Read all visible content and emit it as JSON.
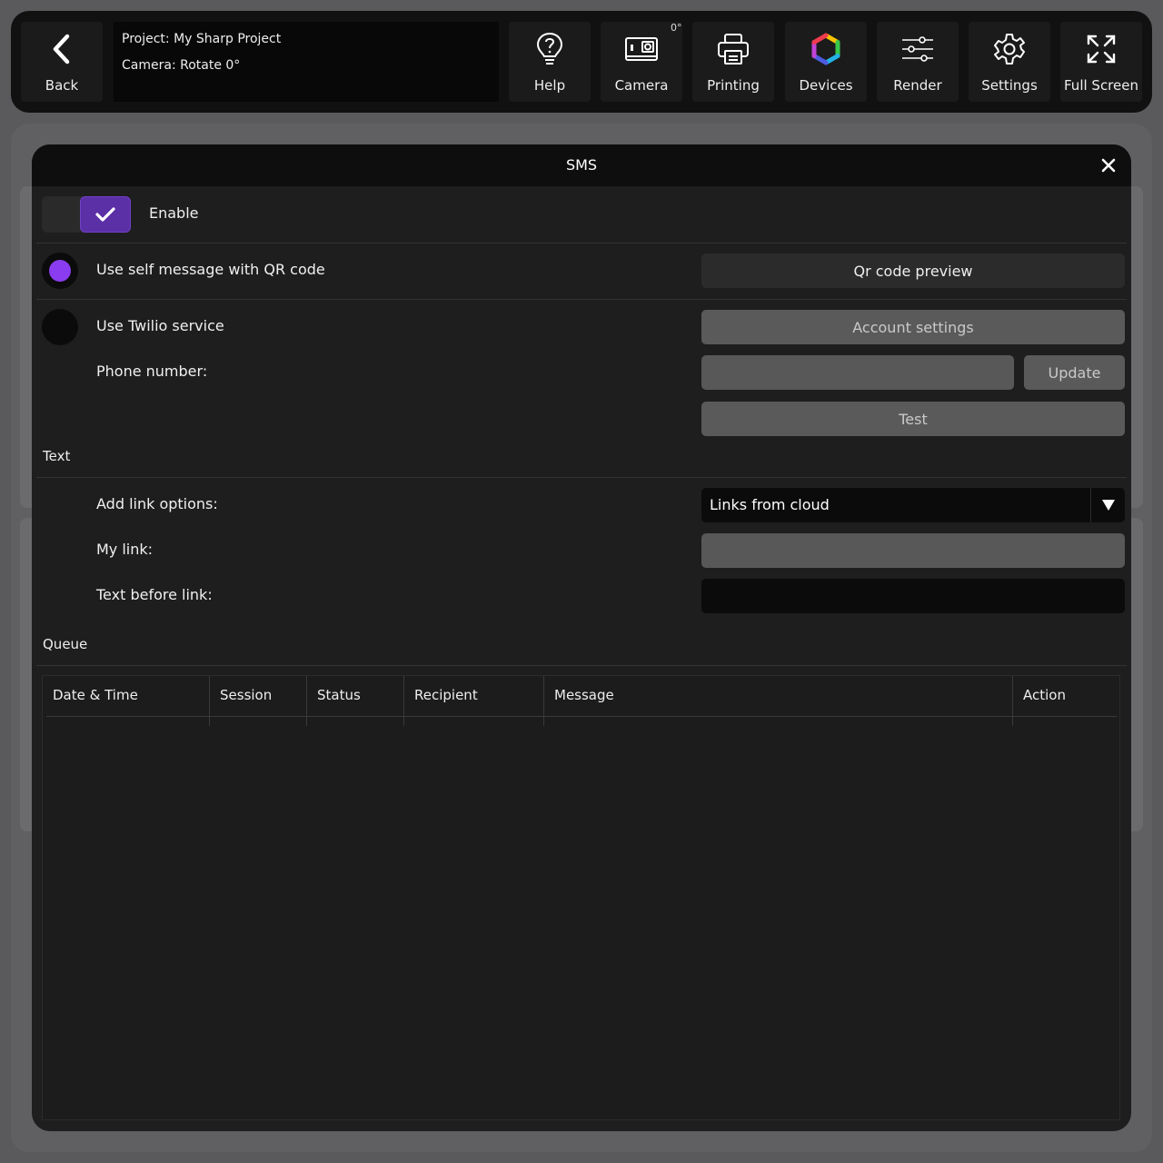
{
  "toolbar": {
    "back_label": "Back",
    "project_line": "Project: My Sharp Project",
    "camera_line": "Camera: Rotate 0°",
    "rotation_badge": "0°",
    "help_label": "Help",
    "camera_label": "Camera",
    "printing_label": "Printing",
    "devices_label": "Devices",
    "render_label": "Render",
    "settings_label": "Settings",
    "fullscreen_label": "Full Screen"
  },
  "modal": {
    "title": "SMS",
    "enable_label": "Enable",
    "enable_checked": true,
    "option_qr_label": "Use self message with QR code",
    "option_qr_selected": true,
    "qr_preview_button": "Qr code preview",
    "option_twilio_label": "Use Twilio service",
    "option_twilio_selected": false,
    "account_settings_button": "Account settings",
    "phone_number_label": "Phone number:",
    "phone_number_value": "",
    "update_button": "Update",
    "test_button": "Test",
    "text_section": "Text",
    "add_link_label": "Add link options:",
    "add_link_value": "Links from cloud",
    "my_link_label": "My link:",
    "my_link_value": "",
    "text_before_link_label": "Text before link:",
    "text_before_link_value": "",
    "queue_section": "Queue",
    "queue_columns": [
      "Date & Time",
      "Session",
      "Status",
      "Recipient",
      "Message",
      "Action"
    ],
    "queue_rows": []
  },
  "colors": {
    "accent_purple": "#8a3cf0",
    "toggle_purple": "#5b2fa6",
    "modal_bg": "#1e1e1f",
    "toolbar_bg": "#111111"
  }
}
